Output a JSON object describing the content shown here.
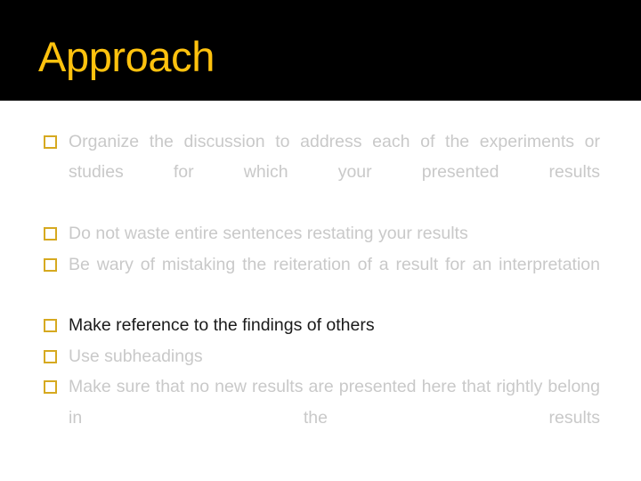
{
  "slide": {
    "title": "Approach",
    "title_color": "#ffc20e",
    "title_band_color": "#000000",
    "background_color": "#ffffff",
    "body_text_color": "#c9c9c9",
    "emphasis_text_color": "#1a1a1a",
    "bullet_marker_color": "#d6a920",
    "bullet_marker_icon": "hollow-square-bullet-icon"
  },
  "bullets": [
    {
      "id": "bullet-organize-discussion",
      "text": "Organize the discussion to address each of the experiments or studies for which your presented results",
      "emphasis": false,
      "justified": true
    },
    {
      "id": "bullet-do-not-waste-sentences",
      "text": "Do not waste entire sentences restating your results",
      "emphasis": false,
      "justified": false
    },
    {
      "id": "bullet-be-wary-of-mistaking",
      "text": "Be wary of mistaking the reiteration of a result for an interpretation",
      "emphasis": false,
      "justified": true
    },
    {
      "id": "bullet-make-reference-to-findings",
      "text": " Make reference to the findings of others",
      "emphasis": true,
      "justified": false
    },
    {
      "id": "bullet-use-subheadings",
      "text": "Use subheadings",
      "emphasis": false,
      "justified": false
    },
    {
      "id": "bullet-no-new-results",
      "text": "Make sure that no new results are presented here that rightly belong in the results",
      "emphasis": false,
      "justified": true
    }
  ]
}
